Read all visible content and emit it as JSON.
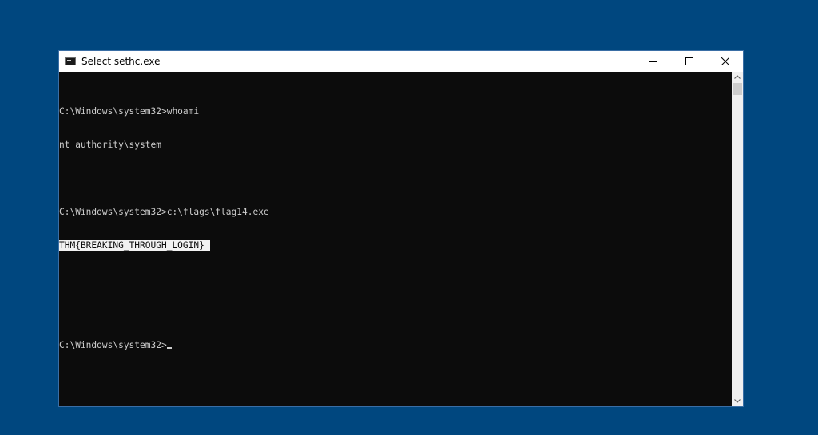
{
  "window": {
    "title": "Select sethc.exe",
    "icon": "console-icon",
    "controls": [
      "minimize-icon",
      "maximize-icon",
      "close-icon"
    ]
  },
  "console": {
    "lines": [
      "C:\\Windows\\system32>whoami",
      "nt authority\\system",
      "",
      "C:\\Windows\\system32>c:\\flags\\flag14.exe",
      "THM{BREAKING_THROUGH_LOGIN}",
      "",
      "",
      "C:\\Windows\\system32>"
    ],
    "selected_text": "THM{BREAKING_THROUGH_LOGIN}"
  },
  "colors": {
    "desktop_background": "#00477f",
    "console_background": "#0c0c0c",
    "console_text": "#cccccc",
    "selection_background": "#f2f2f2"
  }
}
